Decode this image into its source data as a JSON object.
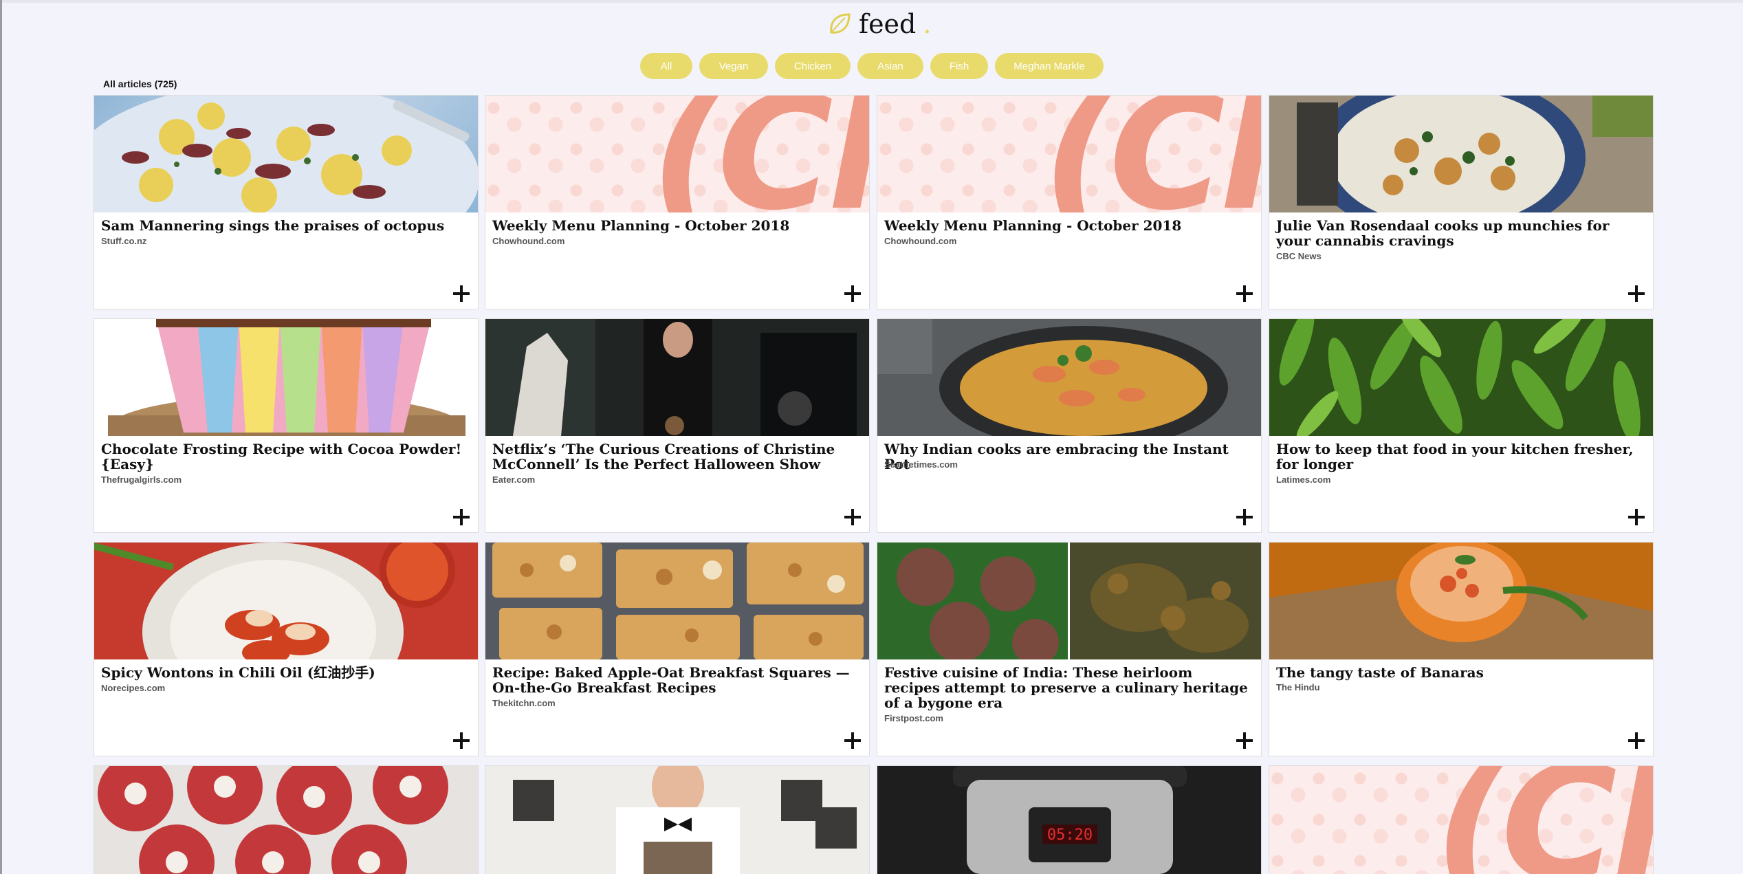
{
  "app": {
    "logo_text": "feed",
    "logo_dot": "."
  },
  "filters": [
    {
      "label": "All"
    },
    {
      "label": "Vegan"
    },
    {
      "label": "Chicken"
    },
    {
      "label": "Asian"
    },
    {
      "label": "Fish"
    },
    {
      "label": "Meghan Markle"
    }
  ],
  "count_label": "All articles (725)",
  "colors": {
    "accent": "#e8db6c",
    "background": "#f3f3fb",
    "chowhound": "#ef9a86"
  },
  "ch_mark": "(Ch",
  "articles": [
    {
      "title": "Sam Mannering sings the praises of octopus",
      "source": "Stuff.co.nz",
      "image": "octopus-potato-salad"
    },
    {
      "title": "Weekly Menu Planning - October 2018",
      "source": "Chowhound.com",
      "image": "chowhound-logo"
    },
    {
      "title": "Weekly Menu Planning - October 2018",
      "source": "Chowhound.com",
      "image": "chowhound-logo"
    },
    {
      "title": "Julie Van Rosendaal cooks up munchies for your cannabis cravings",
      "source": "CBC News",
      "image": "snack-bowl"
    },
    {
      "title": "Chocolate Frosting Recipe with Cocoa Powder! {Easy}",
      "source": "Thefrugalgirls.com",
      "image": "cupcake-liners"
    },
    {
      "title": "Netflix’s ‘The Curious Creations of Christine McConnell’ Is the Perfect Halloween Show",
      "source": "Eater.com",
      "image": "halloween-show"
    },
    {
      "title": "Why Indian cooks are embracing the Instant Pot",
      "source": "Seattletimes.com",
      "image": "biryani-pan"
    },
    {
      "title": "How to keep that food in your kitchen fresher, for longer",
      "source": "Latimes.com",
      "image": "green-peppers"
    },
    {
      "title": "Spicy Wontons in Chili Oil (红油抄手)",
      "source": "Norecipes.com",
      "image": "wontons-chili"
    },
    {
      "title": "Recipe: Baked Apple-Oat Breakfast Squares — On-the-Go Breakfast Recipes",
      "source": "Thekitchn.com",
      "image": "oat-squares"
    },
    {
      "title": "Festive cuisine of India: These heirloom recipes attempt to preserve a culinary heritage of a bygone era",
      "source": "Firstpost.com",
      "image": "indian-fritters"
    },
    {
      "title": "The tangy taste of Banaras",
      "source": "The Hindu",
      "image": "tangy-bowl"
    },
    {
      "title": "",
      "source": "",
      "image": "osso-buco"
    },
    {
      "title": "",
      "source": "",
      "image": "chef"
    },
    {
      "title": "",
      "source": "",
      "image": "instant-pot"
    },
    {
      "title": "",
      "source": "",
      "image": "chowhound-logo"
    }
  ]
}
